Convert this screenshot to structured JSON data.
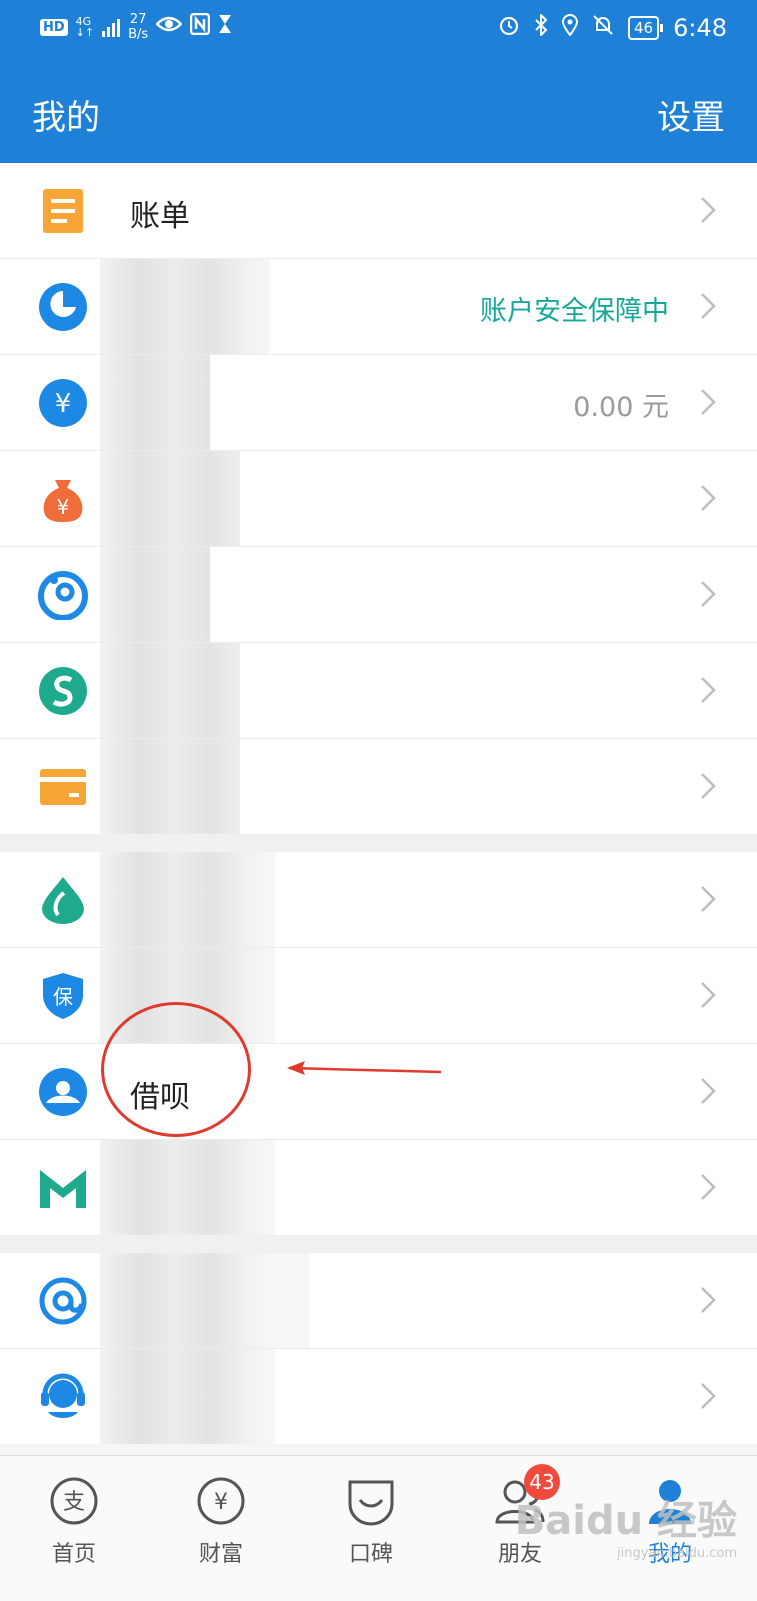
{
  "status_bar": {
    "hd": "HD",
    "network": "4G",
    "speed_value": "27",
    "speed_unit": "B/s",
    "battery": "46",
    "time": "6:48"
  },
  "header": {
    "title": "我的",
    "settings": "设置"
  },
  "groups": [
    {
      "rows": [
        {
          "icon": "bill-icon",
          "color": "#f7a536",
          "label": "账单",
          "value": ""
        },
        {
          "icon": "pie-chart-icon",
          "color": "#1e88e5",
          "label": "",
          "value": "账户安全保障中",
          "value_color": "#15a89a"
        },
        {
          "icon": "yuan-coin-icon",
          "color": "#1e88e5",
          "label": "",
          "value": "0.00 元"
        },
        {
          "icon": "money-bag-icon",
          "color": "#f06d3a",
          "label": "",
          "value": ""
        },
        {
          "icon": "yuebao-icon",
          "color": "#1e88e5",
          "label": "",
          "value": ""
        },
        {
          "icon": "s-swirl-icon",
          "color": "#1faa8d",
          "label": "",
          "value": ""
        },
        {
          "icon": "bank-card-icon",
          "color": "#f7a536",
          "label": "",
          "value": ""
        }
      ]
    },
    {
      "rows": [
        {
          "icon": "sesame-drop-icon",
          "color": "#1faa8d",
          "label": "",
          "value": ""
        },
        {
          "icon": "insurance-shield-icon",
          "color": "#1e88e5",
          "label": "",
          "value": ""
        },
        {
          "icon": "jiebei-icon",
          "color": "#1e88e5",
          "label": "借呗",
          "value": ""
        },
        {
          "icon": "mybank-m-icon",
          "color": "#1faa8d",
          "label": "",
          "value": ""
        }
      ]
    },
    {
      "rows": [
        {
          "icon": "at-sign-icon",
          "color": "#1e88e5",
          "label": "",
          "value": ""
        },
        {
          "icon": "customer-service-icon",
          "color": "#1e88e5",
          "label": "",
          "value": ""
        }
      ]
    }
  ],
  "tabs": [
    {
      "label": "首页",
      "icon": "alipay-home-icon",
      "active": false
    },
    {
      "label": "财富",
      "icon": "wealth-yuan-icon",
      "active": false
    },
    {
      "label": "口碑",
      "icon": "koubei-icon",
      "active": false
    },
    {
      "label": "朋友",
      "icon": "friends-icon",
      "active": false,
      "badge": "43"
    },
    {
      "label": "我的",
      "icon": "me-icon",
      "active": true
    }
  ],
  "colors": {
    "primary": "#1e80d6",
    "green_text": "#15a89a",
    "badge": "#f04a3d",
    "annotation": "#e03b30"
  },
  "watermark": {
    "main": "Baidu 经验",
    "sub": "jingyan.baidu.com"
  }
}
